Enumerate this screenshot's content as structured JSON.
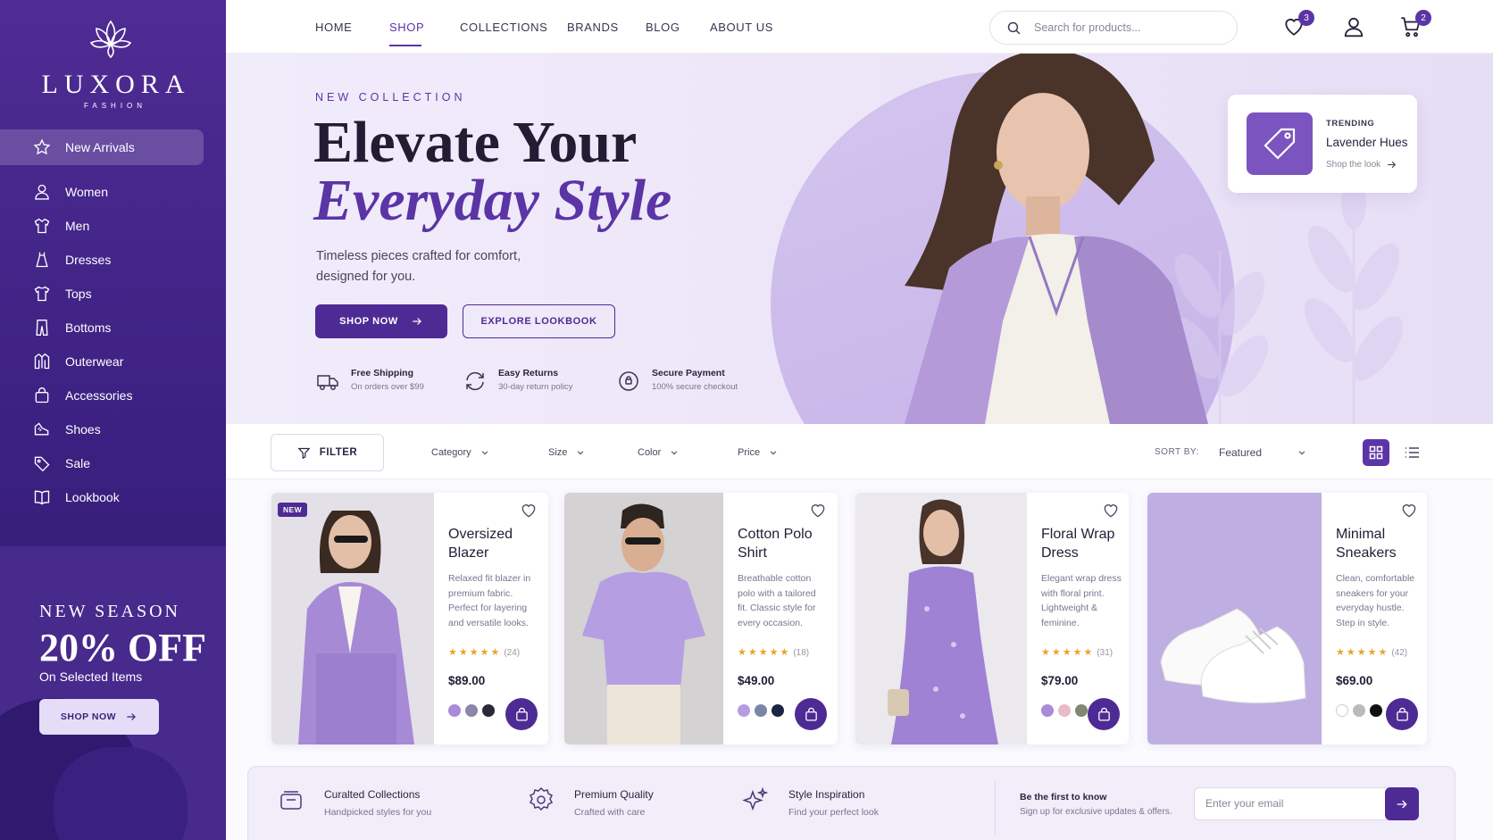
{
  "brand": {
    "name": "LUXORA",
    "tagline": "FASHION",
    "logo_icon": "lotus-icon"
  },
  "sidebar": {
    "items": [
      {
        "label": "New Arrivals",
        "icon": "star-icon",
        "active": true
      },
      {
        "label": "Women",
        "icon": "user-icon"
      },
      {
        "label": "Men",
        "icon": "shirt-icon"
      },
      {
        "label": "Dresses",
        "icon": "dress-icon"
      },
      {
        "label": "Tops",
        "icon": "top-icon"
      },
      {
        "label": "Bottoms",
        "icon": "pants-icon"
      },
      {
        "label": "Outerwear",
        "icon": "jacket-icon"
      },
      {
        "label": "Accessories",
        "icon": "bag-icon"
      },
      {
        "label": "Shoes",
        "icon": "shoe-icon"
      },
      {
        "label": "Sale",
        "icon": "tag-icon"
      },
      {
        "label": "Lookbook",
        "icon": "book-icon"
      }
    ],
    "promo": {
      "line1": "NEW SEASON",
      "headline": "20% OFF",
      "sub": "On Selected Items",
      "button": "SHOP NOW"
    }
  },
  "topnav": {
    "links": [
      "HOME",
      "SHOP",
      "COLLECTIONS",
      "BRANDS",
      "BLOG",
      "ABOUT US"
    ],
    "active": "SHOP",
    "search_placeholder": "Search for products...",
    "wishlist_count": "3",
    "cart_count": "2"
  },
  "hero": {
    "eyebrow": "NEW COLLECTION",
    "title_line1": "Elevate Your",
    "title_line2": "Everyday Style",
    "description": "Timeless pieces crafted for comfort, designed for you.",
    "primary_button": "SHOP NOW",
    "secondary_button": "EXPLORE LOOKBOOK",
    "features": [
      {
        "title": "Free Shipping",
        "sub": "On orders over $99",
        "icon": "truck-icon"
      },
      {
        "title": "Easy Returns",
        "sub": "30-day return policy",
        "icon": "refresh-icon"
      },
      {
        "title": "Secure Payment",
        "sub": "100% secure checkout",
        "icon": "shield-icon"
      }
    ],
    "trending": {
      "label": "TRENDING",
      "name": "Lavender Hues",
      "link": "Shop the look"
    }
  },
  "filters": {
    "button": "FILTER",
    "dropdowns": [
      "Category",
      "Size",
      "Color",
      "Price"
    ],
    "sort_label": "SORT BY:",
    "sort_value": "Featured"
  },
  "products": [
    {
      "name": "Oversized Blazer",
      "desc": "Relaxed fit blazer in premium fabric. Perfect for layering and versatile looks.",
      "rating": 5,
      "reviews": "(24)",
      "price": "$89.00",
      "badge": "NEW",
      "swatches": [
        "#a98bd8",
        "#8c86a8",
        "#2b2838"
      ]
    },
    {
      "name": "Cotton Polo Shirt",
      "desc": "Breathable cotton polo with a tailored fit. Classic style for every occasion.",
      "rating": 5,
      "reviews": "(18)",
      "price": "$49.00",
      "swatches": [
        "#b49de0",
        "#7a85a8",
        "#1e2444"
      ]
    },
    {
      "name": "Floral Wrap Dress",
      "desc": "Elegant wrap dress with floral print. Lightweight & feminine.",
      "rating": 5,
      "reviews": "(31)",
      "price": "$79.00",
      "swatches": [
        "#a98bd8",
        "#e8bcc4",
        "#7d8a70"
      ]
    },
    {
      "name": "Minimal Sneakers",
      "desc": "Clean, comfortable sneakers for your everyday hustle. Step in style.",
      "rating": 5,
      "reviews": "(42)",
      "price": "$69.00",
      "swatches": [
        "#ffffff",
        "#b9b9be",
        "#111111"
      ]
    }
  ],
  "footer": {
    "perks": [
      {
        "title": "Curalted Collections",
        "sub": "Handpicked styles for you",
        "icon": "box-icon"
      },
      {
        "title": "Premium Quality",
        "sub": "Crafted with care",
        "icon": "badge-icon"
      },
      {
        "title": "Style Inspiration",
        "sub": "Find your perfect look",
        "icon": "sparkle-icon"
      }
    ],
    "newsletter_title": "Be the first to know",
    "newsletter_sub": "Sign up for exclusive updates & offers.",
    "email_placeholder": "Enter your email"
  },
  "colors": {
    "primary": "#4e2b94",
    "accent": "#5b34a6",
    "lavender": "#c3b0e6",
    "star": "#e6a52a"
  }
}
